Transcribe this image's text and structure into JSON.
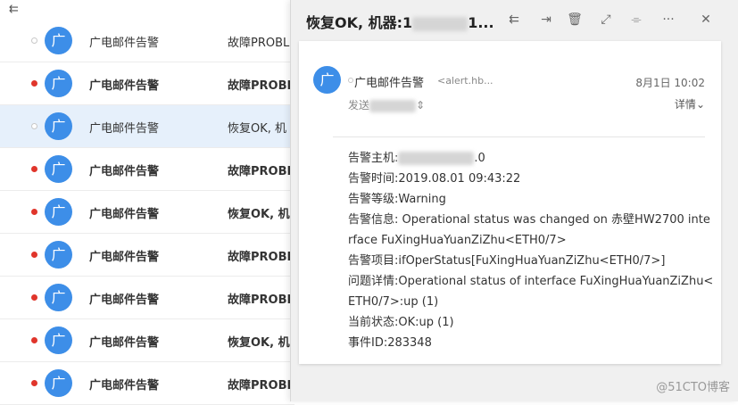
{
  "toolbar": {
    "collapse_icon": "collapse-list-icon",
    "collapse_glyph": "⇇"
  },
  "avatar_char": "广",
  "list": [
    {
      "sender": "广电邮件告警",
      "subject": "故障PROBL",
      "unread": false,
      "selected": false
    },
    {
      "sender": "广电邮件告警",
      "subject": "故障PROBL",
      "unread": true,
      "selected": false
    },
    {
      "sender": "广电邮件告警",
      "subject": "恢复OK, 机",
      "unread": false,
      "selected": true
    },
    {
      "sender": "广电邮件告警",
      "subject": "故障PROBL",
      "unread": true,
      "selected": false
    },
    {
      "sender": "广电邮件告警",
      "subject": "恢复OK, 机",
      "unread": true,
      "selected": false
    },
    {
      "sender": "广电邮件告警",
      "subject": "故障PROBL",
      "unread": true,
      "selected": false
    },
    {
      "sender": "广电邮件告警",
      "subject": "故障PROBL",
      "unread": true,
      "selected": false
    },
    {
      "sender": "广电邮件告警",
      "subject": "恢复OK, 机",
      "unread": true,
      "selected": false
    },
    {
      "sender": "广电邮件告警",
      "subject": "故障PROBL",
      "unread": true,
      "selected": false
    }
  ],
  "reader": {
    "title_prefix": "恢复OK, 机器:1",
    "title_suffix": "1...",
    "tools": [
      {
        "name": "reply-all-icon",
        "glyph": "⇇"
      },
      {
        "name": "forward-icon",
        "glyph": "⇥"
      },
      {
        "name": "trash-icon",
        "glyph": "🗑"
      },
      {
        "name": "expand-icon",
        "glyph": "⤢"
      },
      {
        "name": "strikethrough-icon",
        "glyph": "⌯"
      },
      {
        "name": "more-icon",
        "glyph": "···"
      },
      {
        "name": "close-icon",
        "glyph": "✕"
      }
    ],
    "from_name": "广电邮件告警",
    "from_addr": "<alert.hb...",
    "date": "8月1日 10:02",
    "to_label": "发送",
    "to_chevron": "⇕",
    "details": "详情",
    "details_chevron": "⌄",
    "body": {
      "host_label": "告警主机:",
      "host_suffix": ".0",
      "lines": [
        "告警时间:2019.08.01 09:43:22",
        "告警等级:Warning",
        "告警信息: Operational status was changed on 赤壁HW2700 inte",
        "rface FuXingHuaYuanZiZhu<ETH0/7>",
        "告警项目:ifOperStatus[FuXingHuaYuanZiZhu<ETH0/7>]",
        "问题详情:Operational status of interface FuXingHuaYuanZiZhu<",
        "ETH0/7>:up (1)",
        "当前状态:OK:up (1)",
        "事件ID:283348"
      ]
    }
  },
  "watermark": "@51CTO博客"
}
